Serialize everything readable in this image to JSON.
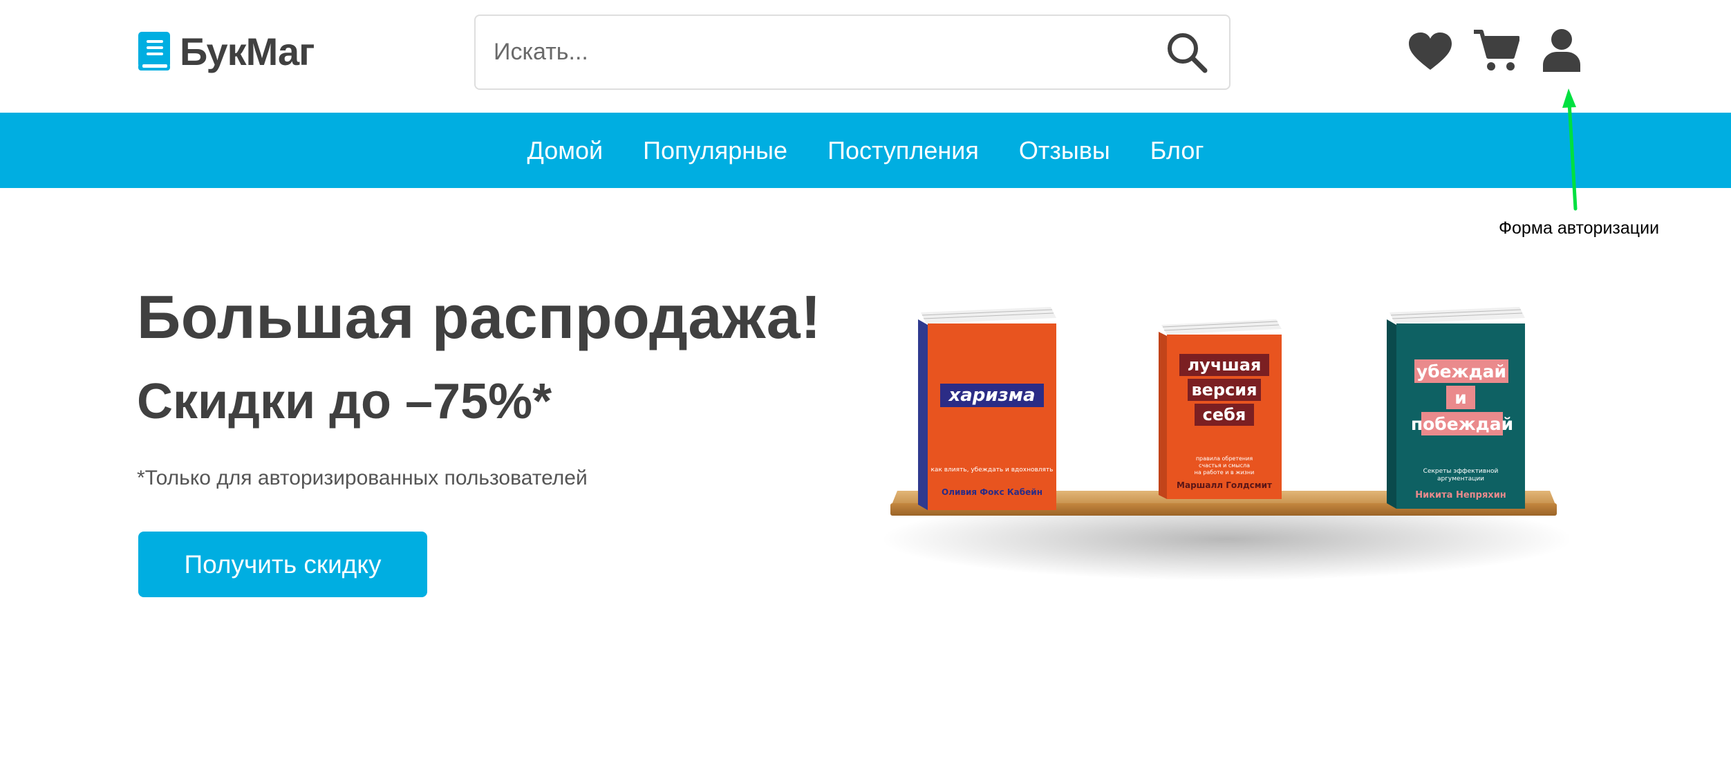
{
  "brand": {
    "name": "БукМаг",
    "accent_color": "#00aee1",
    "icon": "book-icon"
  },
  "search": {
    "placeholder": "Искать...",
    "icon": "search-icon"
  },
  "header_icons": [
    "heart-icon",
    "cart-icon",
    "user-icon"
  ],
  "nav": {
    "items": [
      {
        "label": "Домой"
      },
      {
        "label": "Популярные"
      },
      {
        "label": "Поступления"
      },
      {
        "label": "Отзывы"
      },
      {
        "label": "Блог"
      }
    ]
  },
  "annotation": {
    "text": "Форма авторизации",
    "color": "#00e040"
  },
  "hero": {
    "title": "Большая распродажа!",
    "subtitle": "Скидки до –75%*",
    "note": "*Только для авторизированных пользователей",
    "button_label": "Получить скидку"
  },
  "books": [
    {
      "title": "харизма",
      "tagline": "как влиять, убеждать и вдохновлять",
      "author": "Оливия Фокс Кабейн",
      "cover_color": "#e8541f",
      "label_color": "#2b2c86"
    },
    {
      "title_lines": [
        "лучшая",
        "версия",
        "себя"
      ],
      "tagline_lines": [
        "правила обретения",
        "счастья и смысла",
        "на работе и в жизни"
      ],
      "author": "Маршалл Голдсмит",
      "cover_color": "#e8541f",
      "label_color": "#7b1f22"
    },
    {
      "title_lines": [
        "убеждай",
        "и",
        "побеждай"
      ],
      "tagline_lines": [
        "Секреты эффективной",
        "аргументации"
      ],
      "author": "Никита Непряхин",
      "cover_color": "#0e6163",
      "label_color": "#ea8a8c"
    }
  ]
}
